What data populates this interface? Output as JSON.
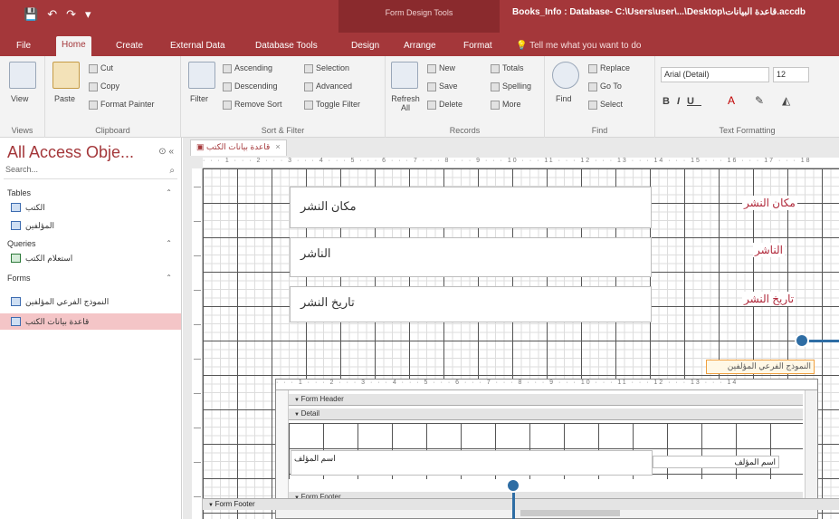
{
  "titlebar": {
    "qat": [
      "💾",
      "↶",
      "↷",
      "▾"
    ],
    "context_tools": "Form Design Tools",
    "doc_title": "Books_Info : Database- C:\\Users\\user\\...\\Desktop\\قاعدة البيانات.accdb"
  },
  "tabs": [
    {
      "label": "File",
      "active": false
    },
    {
      "label": "Home",
      "active": true
    },
    {
      "label": "Create",
      "active": false
    },
    {
      "label": "External Data",
      "active": false
    },
    {
      "label": "Database Tools",
      "active": false
    },
    {
      "label": "Design",
      "active": false
    },
    {
      "label": "Arrange",
      "active": false
    },
    {
      "label": "Format",
      "active": false
    }
  ],
  "tellme": "Tell me what you want to do",
  "ribbon": {
    "views": {
      "view": "View",
      "group": "Views"
    },
    "clipboard": {
      "paste": "Paste",
      "cut": "Cut",
      "copy": "Copy",
      "format_painter": "Format Painter",
      "group": "Clipboard"
    },
    "sort_filter": {
      "filter": "Filter",
      "ascending": "Ascending",
      "descending": "Descending",
      "remove_sort": "Remove Sort",
      "selection": "Selection",
      "advanced": "Advanced",
      "toggle_filter": "Toggle Filter",
      "group": "Sort & Filter"
    },
    "records": {
      "refresh": "Refresh All",
      "new": "New",
      "save": "Save",
      "delete": "Delete",
      "totals": "Totals",
      "spelling": "Spelling",
      "more": "More",
      "group": "Records"
    },
    "find": {
      "find": "Find",
      "replace": "Replace",
      "goto": "Go To",
      "select": "Select",
      "group": "Find"
    },
    "text_formatting": {
      "font": "Arial (Detail)",
      "size": "12",
      "group": "Text Formatting"
    }
  },
  "navpane": {
    "title": "All Access Obje...",
    "search_placeholder": "Search...",
    "sections": [
      {
        "name": "Tables",
        "items": [
          "الكتب",
          "المؤلفين"
        ]
      },
      {
        "name": "Queries",
        "items": [
          "استعلام الكتب"
        ]
      },
      {
        "name": "Forms",
        "items": [
          "النموذج الفرعي المؤلفين",
          "قاعدة بيانات الكتب"
        ]
      }
    ],
    "selected_item": "قاعدة بيانات الكتب"
  },
  "document": {
    "tab_label": "قاعدة بيانات الكتب",
    "fields": [
      {
        "value": "مكان النشر",
        "label": "مكان النشر"
      },
      {
        "value": "الناشر",
        "label": "الناشر"
      },
      {
        "value": "تاريخ النشر",
        "label": "تاريخ النشر"
      }
    ],
    "subform_label": "النموذج الفرعي المؤلفين",
    "subform": {
      "form_header": "Form Header",
      "detail": "Detail",
      "form_footer": "Form Footer",
      "control_value": "اسم المؤلف",
      "control_label": "اسم المؤلف"
    },
    "form_footer": "Form Footer"
  },
  "colors": {
    "accent": "#a4373a",
    "callout": "#2e6da4",
    "label_red": "#b0283a"
  }
}
